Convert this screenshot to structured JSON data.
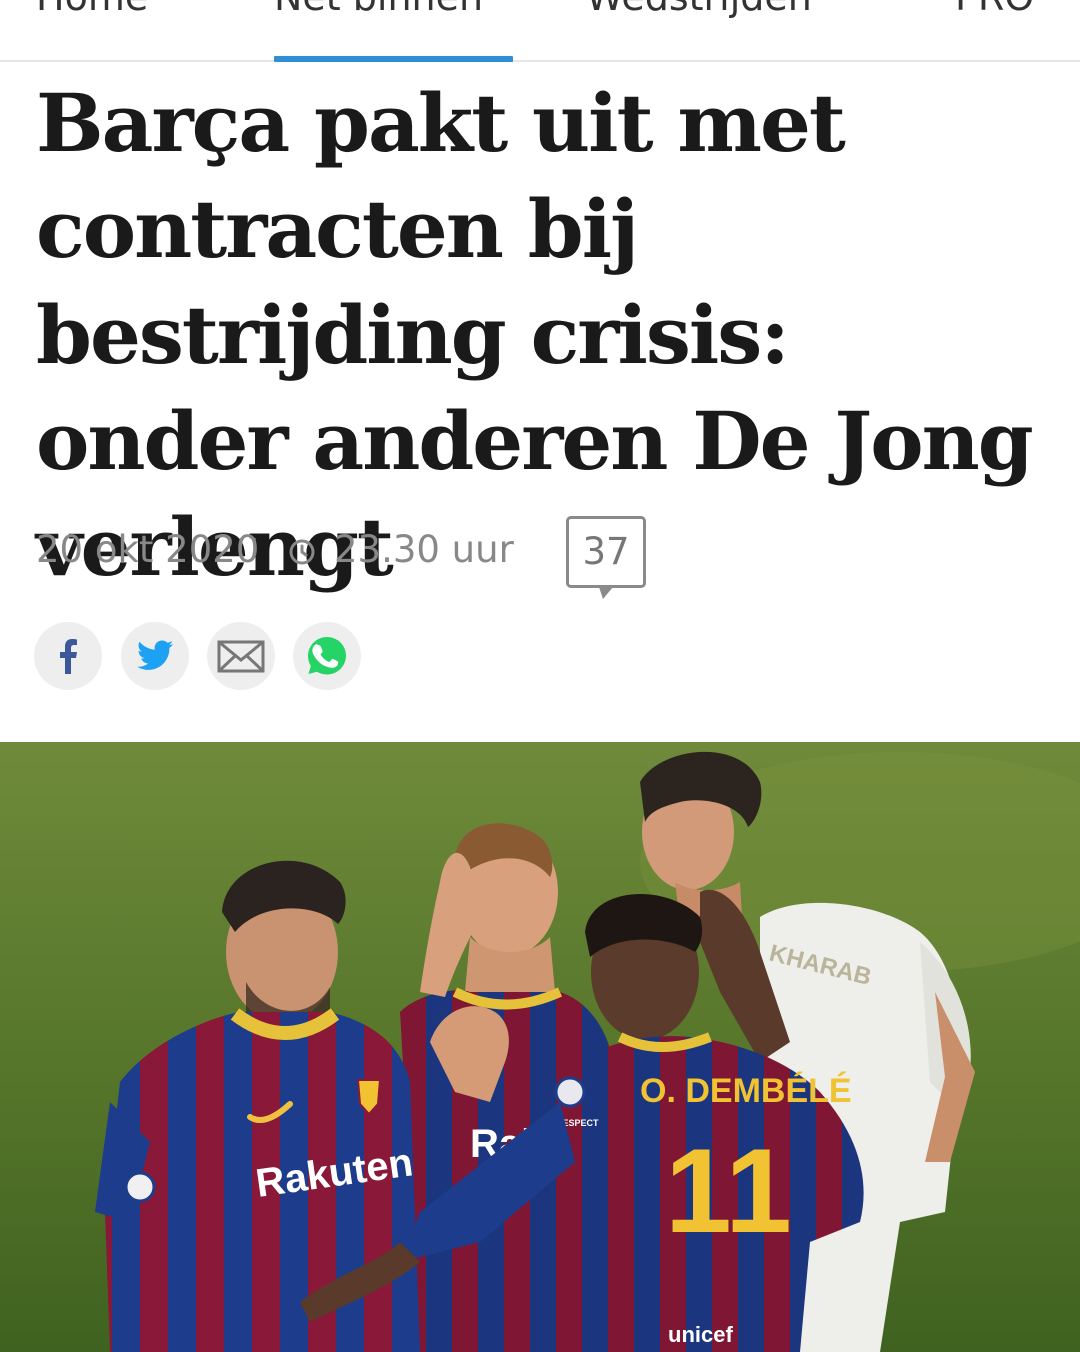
{
  "nav": {
    "tabs": [
      {
        "label": "Home"
      },
      {
        "label": "Net binnen"
      },
      {
        "label": "Wedstrijden"
      },
      {
        "label": "PRO"
      }
    ],
    "active_index": 1,
    "accent_color": "#2f8fd6"
  },
  "article": {
    "title": "Barça pakt uit met contracten bij bestrijding crisis: onder anderen De Jong verlengt",
    "date": "20 okt 2020",
    "time": "23.30 uur",
    "comment_count": "37"
  },
  "share": {
    "icons": [
      "facebook-icon",
      "twitter-icon",
      "mail-icon",
      "whatsapp-icon"
    ]
  },
  "hero_image": {
    "jersey_sponsor": "Rakuten",
    "jersey_name": "O. DEMBÉLÉ",
    "jersey_number": "11",
    "opponent_name": "KHARAB",
    "sleeve_sponsor": "unicef",
    "sleeve_badge": "RESPECT"
  }
}
